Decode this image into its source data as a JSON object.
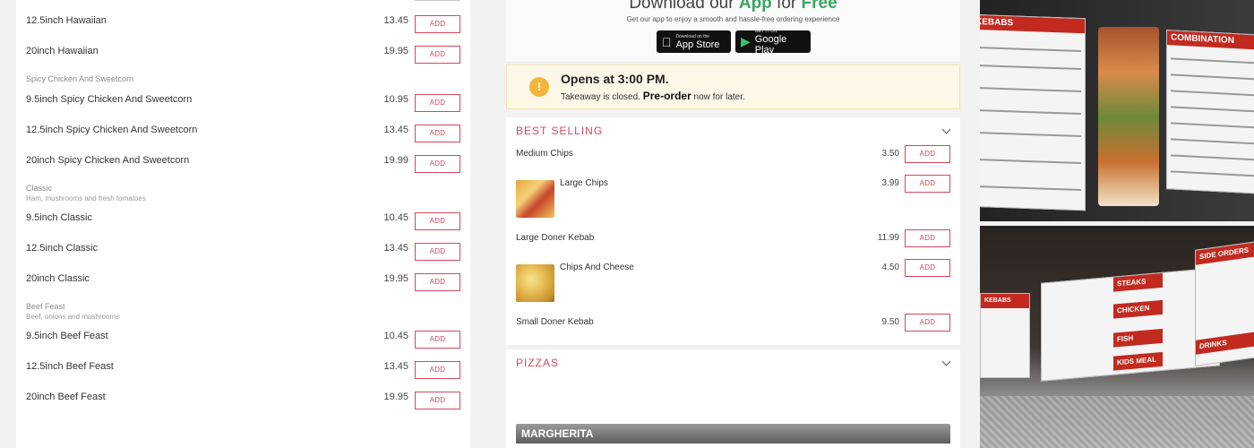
{
  "add_label": "ADD",
  "left_menu": {
    "items_top": [
      {
        "name": "12.5inch Hawaiian",
        "price": "13.45"
      },
      {
        "name": "20inch Hawaiian",
        "price": "19.95"
      }
    ],
    "sections": [
      {
        "title": "Spicy Chicken And Sweetcorn",
        "description": "",
        "items": [
          {
            "name": "9.5inch Spicy Chicken And Sweetcorn",
            "price": "10.95"
          },
          {
            "name": "12.5inch Spicy Chicken And Sweetcorn",
            "price": "13.45"
          },
          {
            "name": "20inch Spicy Chicken And Sweetcorn",
            "price": "19.99"
          }
        ]
      },
      {
        "title": "Classic",
        "description": "Ham, mushrooms and fresh tomatoes",
        "items": [
          {
            "name": "9.5inch Classic",
            "price": "10.45"
          },
          {
            "name": "12.5inch Classic",
            "price": "13.45"
          },
          {
            "name": "20inch Classic",
            "price": "19.95"
          }
        ]
      },
      {
        "title": "Beef Feast",
        "description": "Beef, onions and mushrooms",
        "items": [
          {
            "name": "9.5inch Beef Feast",
            "price": "10.45"
          },
          {
            "name": "12.5inch Beef Feast",
            "price": "13.45"
          },
          {
            "name": "20inch Beef Feast",
            "price": "19.95"
          }
        ]
      }
    ]
  },
  "promo": {
    "headline_pre": "Download our",
    "headline_app": "App",
    "headline_mid": "for",
    "headline_free": "Free",
    "subtitle": "Get our app to enjoy a smooth and hassle-free ordering experience",
    "app_store_small": "Download on the",
    "app_store_big": "App Store",
    "google_play_small": "GET IT ON",
    "google_play_big": "Google Play",
    "accent_color": "#3aa660"
  },
  "notice": {
    "title": "Opens at 3:00 PM.",
    "text_pre": "Takeaway is closed.",
    "text_bold": "Pre-order",
    "text_post": "now for later."
  },
  "best_selling": {
    "title": "BEST SELLING",
    "items": [
      {
        "name": "Medium Chips",
        "price": "3.50"
      },
      {
        "name": "Large Chips",
        "price": "3.99",
        "image": "fries"
      },
      {
        "name": "Large Doner Kebab",
        "price": "11.99"
      },
      {
        "name": "Chips And Cheese",
        "price": "4.50",
        "image": "cheesy-chips"
      },
      {
        "name": "Small Doner Kebab",
        "price": "9.50"
      }
    ]
  },
  "pizzas": {
    "title": "PIZZAS",
    "subheader": "MARGHERITA"
  },
  "photos": {
    "board1_title": "KEBABS",
    "board2_title": "COMBINATION",
    "board3_title": "STEAKS",
    "board4_title": "CHICKEN",
    "board5_title": "FISH",
    "board6_title": "KIDS MEAL",
    "board7_title": "SIDE ORDERS",
    "board8_title": "DRINKS"
  },
  "colors": {
    "brand_red": "#d4485a",
    "warning_yellow": "#f3b63a"
  }
}
